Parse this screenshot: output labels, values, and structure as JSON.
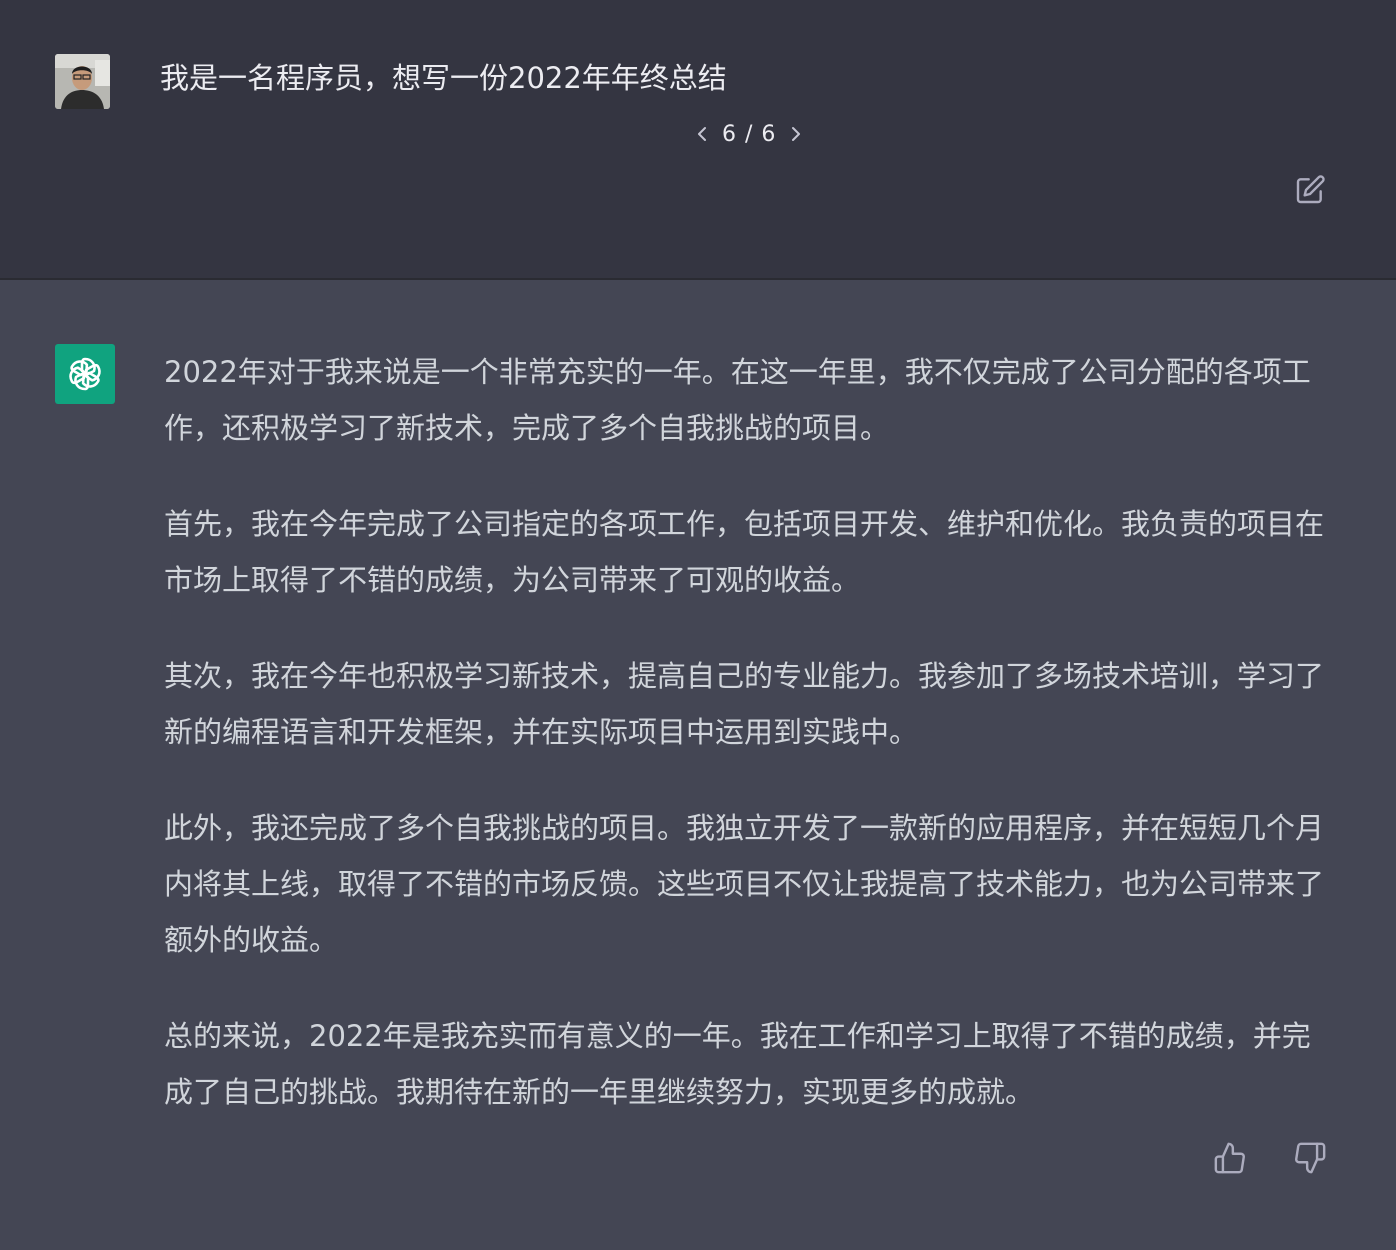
{
  "user_message": {
    "text": "我是一名程序员，想写一份2022年年终总结",
    "avatar_icon": "user-photo-avatar"
  },
  "pager": {
    "current": "6",
    "separator": "/",
    "total": "6",
    "prev_icon": "chevron-left-icon",
    "next_icon": "chevron-right-icon"
  },
  "actions": {
    "edit_icon": "edit-icon",
    "thumbs_up_icon": "thumbs-up-icon",
    "thumbs_down_icon": "thumbs-down-icon"
  },
  "assistant_message": {
    "avatar_icon": "openai-logo-icon",
    "paragraphs": [
      "2022年对于我来说是一个非常充实的一年。在这一年里，我不仅完成了公司分配的各项工作，还积极学习了新技术，完成了多个自我挑战的项目。",
      "首先，我在今年完成了公司指定的各项工作，包括项目开发、维护和优化。我负责的项目在市场上取得了不错的成绩，为公司带来了可观的收益。",
      "其次，我在今年也积极学习新技术，提高自己的专业能力。我参加了多场技术培训，学习了新的编程语言和开发框架，并在实际项目中运用到实践中。",
      "此外，我还完成了多个自我挑战的项目。我独立开发了一款新的应用程序，并在短短几个月内将其上线，取得了不错的市场反馈。这些项目不仅让我提高了技术能力，也为公司带来了额外的收益。",
      "总的来说，2022年是我充实而有意义的一年。我在工作和学习上取得了不错的成绩，并完成了自己的挑战。我期待在新的一年里继续努力，实现更多的成就。"
    ]
  },
  "colors": {
    "user_bg": "#343541",
    "assistant_bg": "#444654",
    "text": "#d1d5db",
    "brand": "#10a37f"
  }
}
